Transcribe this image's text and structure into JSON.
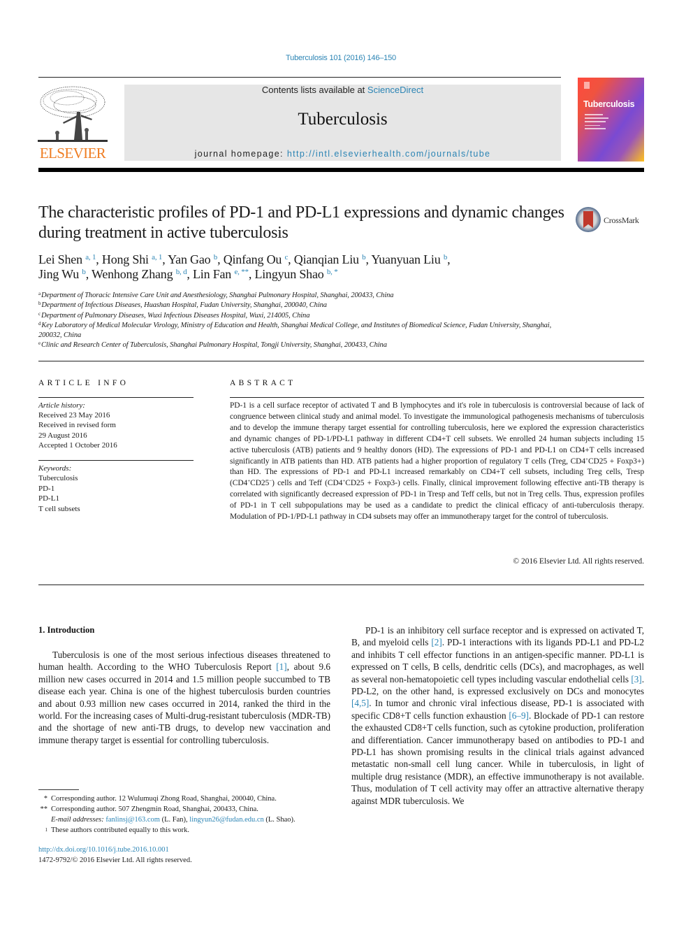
{
  "journal_ref": "Tuberculosis 101 (2016) 146–150",
  "masthead": {
    "publisher_logo_text": "ELSEVIER",
    "contents_prefix": "Contents lists available at ",
    "contents_link": "ScienceDirect",
    "journal_name": "Tuberculosis",
    "homepage_prefix": "journal homepage: ",
    "homepage_url": "http://intl.elsevierhealth.com/journals/tube",
    "cover_title": "Tuberculosis"
  },
  "crossmark_label": "CrossMark",
  "title": "The characteristic profiles of PD-1 and PD-L1 expressions and dynamic changes during treatment in active tuberculosis",
  "authors": [
    {
      "name": "Lei Shen",
      "marks": "a, 1"
    },
    {
      "name": "Hong Shi",
      "marks": "a, 1"
    },
    {
      "name": "Yan Gao",
      "marks": "b"
    },
    {
      "name": "Qinfang Ou",
      "marks": "c"
    },
    {
      "name": "Qianqian Liu",
      "marks": "b"
    },
    {
      "name": "Yuanyuan Liu",
      "marks": "b"
    },
    {
      "name": "Jing Wu",
      "marks": "b"
    },
    {
      "name": "Wenhong Zhang",
      "marks": "b, d"
    },
    {
      "name": "Lin Fan",
      "marks": "e, **"
    },
    {
      "name": "Lingyun Shao",
      "marks": "b, *"
    }
  ],
  "affiliations": [
    {
      "mark": "a",
      "text": "Department of Thoracic Intensive Care Unit and Anesthesiology, Shanghai Pulmonary Hospital, Shanghai, 200433, China"
    },
    {
      "mark": "b",
      "text": "Department of Infectious Diseases, Huashan Hospital, Fudan University, Shanghai, 200040, China"
    },
    {
      "mark": "c",
      "text": "Department of Pulmonary Diseases, Wuxi Infectious Diseases Hospital, Wuxi, 214005, China"
    },
    {
      "mark": "d",
      "text": "Key Laboratory of Medical Molecular Virology, Ministry of Education and Health, Shanghai Medical College, and Institutes of Biomedical Science, Fudan University, Shanghai, 200032, China"
    },
    {
      "mark": "e",
      "text": "Clinic and Research Center of Tuberculosis, Shanghai Pulmonary Hospital, Tongji University, Shanghai, 200433, China"
    }
  ],
  "article_info": {
    "heading": "ARTICLE INFO",
    "history_label": "Article history:",
    "history": [
      "Received 23 May 2016",
      "Received in revised form",
      "29 August 2016",
      "Accepted 1 October 2016"
    ],
    "keywords_label": "Keywords:",
    "keywords": [
      "Tuberculosis",
      "PD-1",
      "PD-L1",
      "T cell subsets"
    ]
  },
  "abstract": {
    "heading": "ABSTRACT",
    "part1": "PD-1 is a cell surface receptor of activated T and B lymphocytes and it's role in tuberculosis is controversial because of lack of congruence between clinical study and animal model. To investigate the immunological pathogenesis mechanisms of tuberculosis and to develop the immune therapy target essential for controlling tuberculosis, here we explored the expression characteristics and dynamic changes of PD-1/PD-L1 pathway in different CD4+T cell subsets. We enrolled 24 human subjects including 15 active tuberculosis (ATB) patients and 9 healthy donors (HD). The expressions of PD-1 and PD-L1 on CD4+T cells increased significantly in ATB patients than HD. ATB patients had a higher proportion of regulatory T cells (Treg, CD4",
    "sup1": "+",
    "part2": "CD25 + Foxp3+) than HD. The expressions of PD-1 and PD-L1 increased remarkably on CD4+T cell subsets, including Treg cells, Tresp (CD4",
    "sup2": "+",
    "part3": "CD25",
    "sup3": "−",
    "part4": ") cells and Teff (CD4",
    "sup4": "+",
    "part5": "CD25 + Foxp3-) cells. Finally, clinical improvement following effective anti-TB therapy is correlated with significantly decreased expression of PD-1 in Tresp and Teff cells, but not in Treg cells. Thus, expression profiles of PD-1 in T cell subpopulations may be used as a candidate to predict the clinical efficacy of anti-tuberculosis therapy. Modulation of PD-1/PD-L1 pathway in CD4 subsets may offer an immunotherapy target for the control of tuberculosis.",
    "copyright": "© 2016 Elsevier Ltd. All rights reserved."
  },
  "introduction": {
    "heading": "1.  Introduction",
    "left": {
      "t1": "Tuberculosis is one of the most serious infectious diseases threatened to human health. According to the WHO Tuberculosis Report ",
      "ref1": "[1]",
      "t2": ", about 9.6 million new cases occurred in 2014 and 1.5 million people succumbed to TB disease each year. China is one of the highest tuberculosis burden countries and about 0.93 million new cases occurred in 2014, ranked the third in the world. For the increasing cases of Multi-drug-resistant tuberculosis (MDR-TB) and the shortage of new anti-TB drugs, to develop new vaccination and immune therapy target is essential for controlling tuberculosis."
    },
    "right": {
      "t1": "PD-1 is an inhibitory cell surface receptor and is expressed on activated T, B, and myeloid cells ",
      "ref1": "[2]",
      "t2": ". PD-1 interactions with its ligands PD-L1 and PD-L2 and inhibits T cell effector functions in an antigen-specific manner. PD-L1 is expressed on T cells, B cells, dendritic cells (DCs), and macrophages, as well as several non-hematopoietic cell types including vascular endothelial cells ",
      "ref2": "[3]",
      "t3": ". PD-L2, on the other hand, is expressed exclusively on DCs and monocytes ",
      "ref3": "[4,5]",
      "t4": ". In tumor and chronic viral infectious disease, PD-1 is associated with specific CD8+T cells function exhaustion ",
      "ref4": "[6–9]",
      "t5": ". Blockade of PD-1 can restore the exhausted CD8+T cells function, such as cytokine production, proliferation and differentiation. Cancer immunotherapy based on antibodies to PD-1 and PD-L1 has shown promising results in the clinical trials against advanced metastatic non-small cell lung cancer. While in tuberculosis, in light of multiple drug resistance (MDR), an effective immunotherapy is not available. Thus, modulation of T cell activity may offer an attractive alternative therapy against MDR tuberculosis. We"
    }
  },
  "footnotes": {
    "corr1_mark": "*",
    "corr1": "Corresponding author. 12 Wulumuqi Zhong Road, Shanghai, 200040, China.",
    "corr2_mark": "**",
    "corr2": "Corresponding author. 507 Zhengmin Road, Shanghai, 200433, China.",
    "email_label": "E-mail addresses:",
    "email1": "fanlinsj@163.com",
    "email1_owner": " (L. Fan), ",
    "email2": "lingyun26@fudan.edu.cn",
    "email2_owner": " (L. Shao).",
    "equal_mark": "1",
    "equal": "These authors contributed equally to this work."
  },
  "doi": "http://dx.doi.org/10.1016/j.tube.2016.10.001",
  "issn": "1472-9792/© 2016 Elsevier Ltd. All rights reserved.",
  "colors": {
    "link": "#2b84b4",
    "elsevier_orange": "#ef7d22",
    "masthead_gray": "#e6e6e6"
  }
}
